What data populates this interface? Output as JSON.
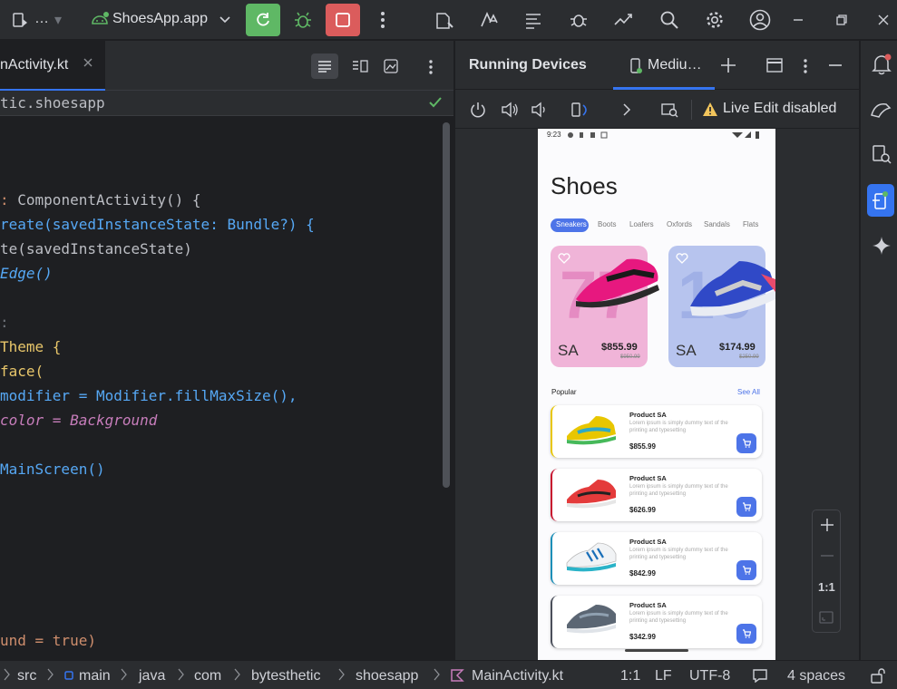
{
  "toolbar": {
    "project_ellipsis": "…",
    "run_config": "ShoesApp.app"
  },
  "editor": {
    "tab_label": "nActivity.kt",
    "breadcrumb": "tic.shoesapp",
    "code": [
      {
        "t": " ComponentActivity() {"
      },
      {
        "t": "reate(savedInstanceState: Bundle?) {"
      },
      {
        "t": "te(savedInstanceState)"
      },
      {
        "t": "Edge()"
      },
      {
        "t": "Theme {"
      },
      {
        "t": "face("
      },
      {
        "t": "modifier = Modifier.fillMaxSize(),"
      },
      {
        "t": "color = Background"
      },
      {
        "t": "MainScreen()"
      },
      {
        "t": "und = true)"
      }
    ]
  },
  "devices": {
    "title": "Running Devices",
    "device_tab": "Mediu…",
    "live_edit": "Live Edit disabled",
    "zoom_ratio": "1:1"
  },
  "phone": {
    "time": "9:23",
    "heading": "Shoes",
    "chips": [
      "Sneakers",
      "Boots",
      "Loafers",
      "Oxfords",
      "Sandals",
      "Flats"
    ],
    "featured": [
      {
        "brand": "SA",
        "price": "$855.99",
        "old_price": "$950.99",
        "bg": "#f0b4d8",
        "num": "77"
      },
      {
        "brand": "SA",
        "price": "$174.99",
        "old_price": "$250.99",
        "bg": "#b7c4ee",
        "num": "16"
      }
    ],
    "popular_label": "Popular",
    "see_all": "See All",
    "products": [
      {
        "name": "Product SA",
        "desc": "Lorem ipsum is simply dummy text of the printing and typesetting",
        "price": "$855.99",
        "accent": "#e8c600"
      },
      {
        "name": "Product SA",
        "desc": "Lorem ipsum is simply dummy text of the printing and typesetting",
        "price": "$626.99",
        "accent": "#c8102e"
      },
      {
        "name": "Product SA",
        "desc": "Lorem ipsum is simply dummy text of the printing and typesetting",
        "price": "$842.99",
        "accent": "#1a8fb8"
      },
      {
        "name": "Product SA",
        "desc": "Lorem ipsum is simply dummy text of the printing and typesetting",
        "price": "$342.99",
        "accent": "#4a4f5a"
      }
    ]
  },
  "statusbar": {
    "crumbs": [
      "src",
      "main",
      "java",
      "com",
      "bytesthetic",
      "shoesapp",
      "MainActivity.kt"
    ],
    "position": "1:1",
    "line_sep": "LF",
    "encoding": "UTF-8",
    "indent": "4 spaces"
  },
  "colors": {
    "accent_blue": "#3574f0",
    "run_green": "#5fb865",
    "stop_red": "#db5c5c",
    "phone_accent": "#4d74e8"
  }
}
